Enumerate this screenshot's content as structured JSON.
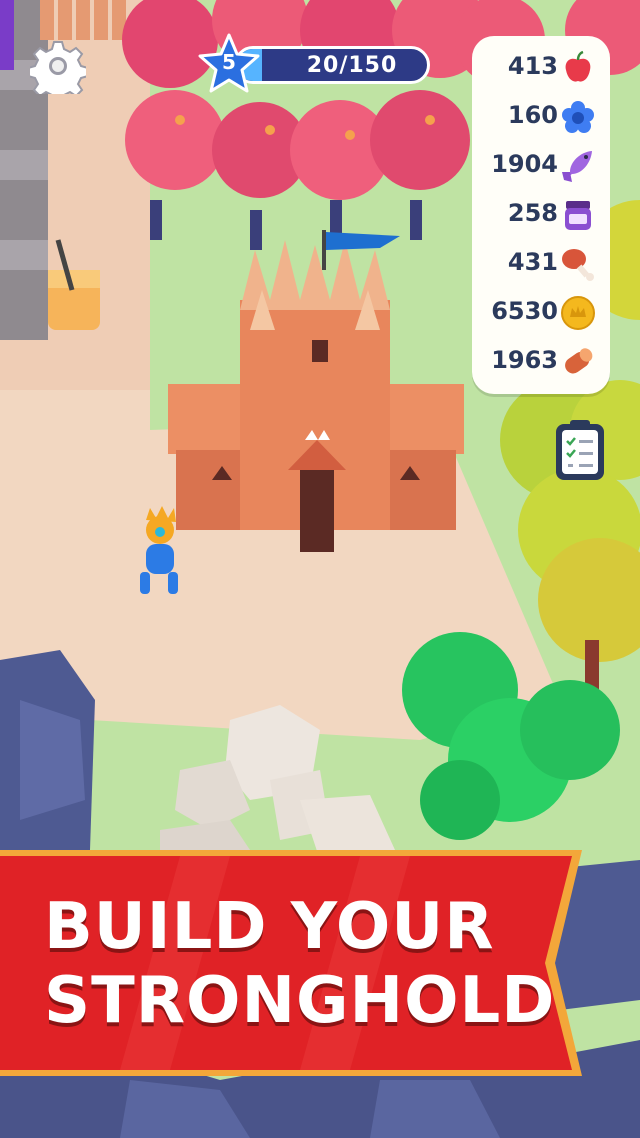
{
  "hud": {
    "level": "5",
    "xp_text": "20/150",
    "xp_progress": 0.133,
    "settings_icon": "gear-icon"
  },
  "resources": [
    {
      "value": "413",
      "icon": "apple-icon",
      "color": "#e83a4a"
    },
    {
      "value": "160",
      "icon": "blue-flower-icon",
      "color": "#3f7df2"
    },
    {
      "value": "1904",
      "icon": "purple-fish-icon",
      "color": "#a066e0"
    },
    {
      "value": "258",
      "icon": "jam-jar-icon",
      "color": "#8b4fd1"
    },
    {
      "value": "431",
      "icon": "meat-leg-icon",
      "color": "#d8553a"
    },
    {
      "value": "6530",
      "icon": "gold-coin-icon",
      "color": "#f4b81e"
    },
    {
      "value": "1963",
      "icon": "wood-log-icon",
      "color": "#d8633a"
    }
  ],
  "quest_icon": "clipboard-icon",
  "banner": {
    "line1": "BUILD YOUR",
    "line2": "STRONGHOLD",
    "color": "#e02226"
  }
}
